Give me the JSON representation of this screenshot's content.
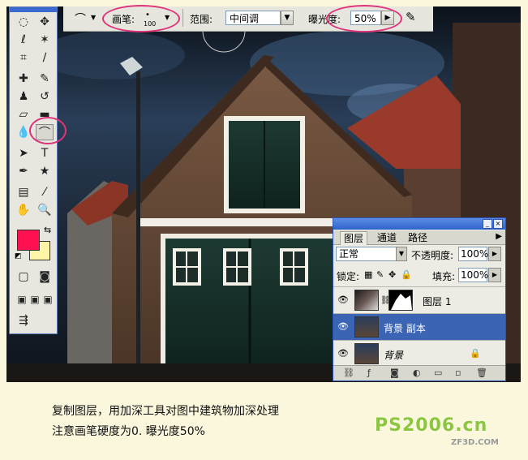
{
  "options_bar": {
    "brush_label": "画笔:",
    "brush_size": "100",
    "range_label": "范围:",
    "range_value": "中间调",
    "exposure_label": "曝光度:",
    "exposure_value": "50%"
  },
  "layers_panel": {
    "tabs": [
      "图层",
      "通道",
      "路径"
    ],
    "blend_mode": "正常",
    "opacity_label": "不透明度:",
    "opacity_value": "100%",
    "lock_label": "锁定:",
    "fill_label": "填充:",
    "fill_value": "100%",
    "layers": [
      {
        "name": "图层 1"
      },
      {
        "name": "背景 副本"
      },
      {
        "name": "背景"
      }
    ]
  },
  "colors": {
    "foreground": "#ff1151",
    "background": "#fff5a9",
    "highlight": "#e0347a",
    "selection": "#3b64b5"
  },
  "caption": {
    "line1": "复制图层，用加深工具对图中建筑物加深处理",
    "line2": "注意画笔硬度为0. 曝光度50%"
  },
  "watermark": {
    "site": "PS2006.cn",
    "subsite": "ZF3D.COM"
  }
}
